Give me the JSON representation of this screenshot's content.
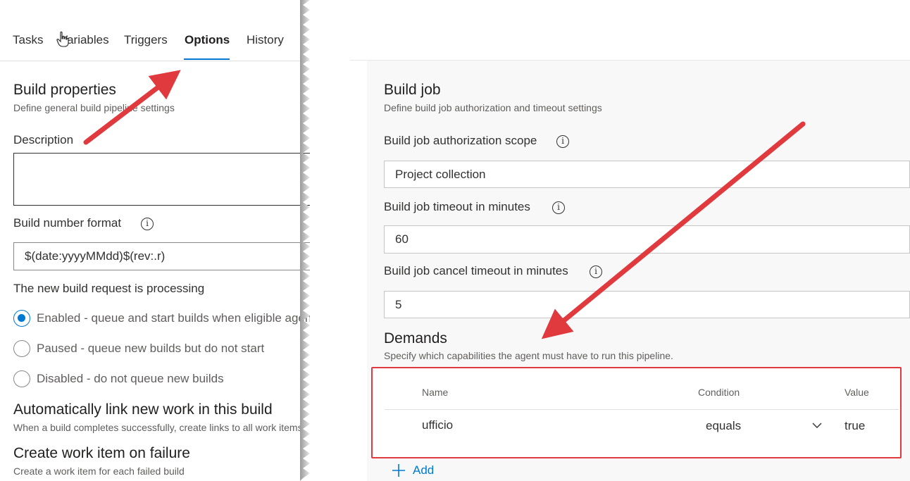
{
  "tabs": [
    {
      "label": "Tasks",
      "active": false
    },
    {
      "label": "Variables",
      "active": false
    },
    {
      "label": "Triggers",
      "active": false
    },
    {
      "label": "Options",
      "active": true
    },
    {
      "label": "History",
      "active": false
    }
  ],
  "build_properties": {
    "title": "Build properties",
    "subtitle": "Define general build pipeline settings",
    "description_label": "Description",
    "description_value": "",
    "number_format_label": "Build number format",
    "number_format_value": "$(date:yyyyMMdd)$(rev:.r)",
    "processing_label": "The new build request is processing",
    "options": [
      {
        "label": "Enabled - queue and start builds when eligible agent(s) available",
        "checked": true
      },
      {
        "label": "Paused - queue new builds but do not start",
        "checked": false
      },
      {
        "label": "Disabled - do not queue new builds",
        "checked": false
      }
    ]
  },
  "auto_link": {
    "title": "Automatically link new work in this build",
    "subtitle": "When a build completes successfully, create links to all work items"
  },
  "create_work_item": {
    "title": "Create work item on failure",
    "subtitle": "Create a work item for each failed build"
  },
  "build_job": {
    "title": "Build job",
    "subtitle": "Define build job authorization and timeout settings",
    "auth_scope_label": "Build job authorization scope",
    "auth_scope_value": "Project collection",
    "timeout_label": "Build job timeout in minutes",
    "timeout_value": "60",
    "cancel_timeout_label": "Build job cancel timeout in minutes",
    "cancel_timeout_value": "5"
  },
  "demands": {
    "title": "Demands",
    "subtitle": "Specify which capabilities the agent must have to run this pipeline.",
    "columns": {
      "name": "Name",
      "condition": "Condition",
      "value": "Value"
    },
    "rows": [
      {
        "name": "ufficio",
        "condition": "equals",
        "value": "true"
      }
    ],
    "add_label": "Add"
  },
  "colors": {
    "accent": "#0078d4",
    "annotation_red": "#e0393e",
    "text": "#323130",
    "muted": "#605e5c"
  },
  "icons": [
    "hand-pointer-icon",
    "info-icon",
    "chevron-down-icon",
    "plus-icon"
  ]
}
